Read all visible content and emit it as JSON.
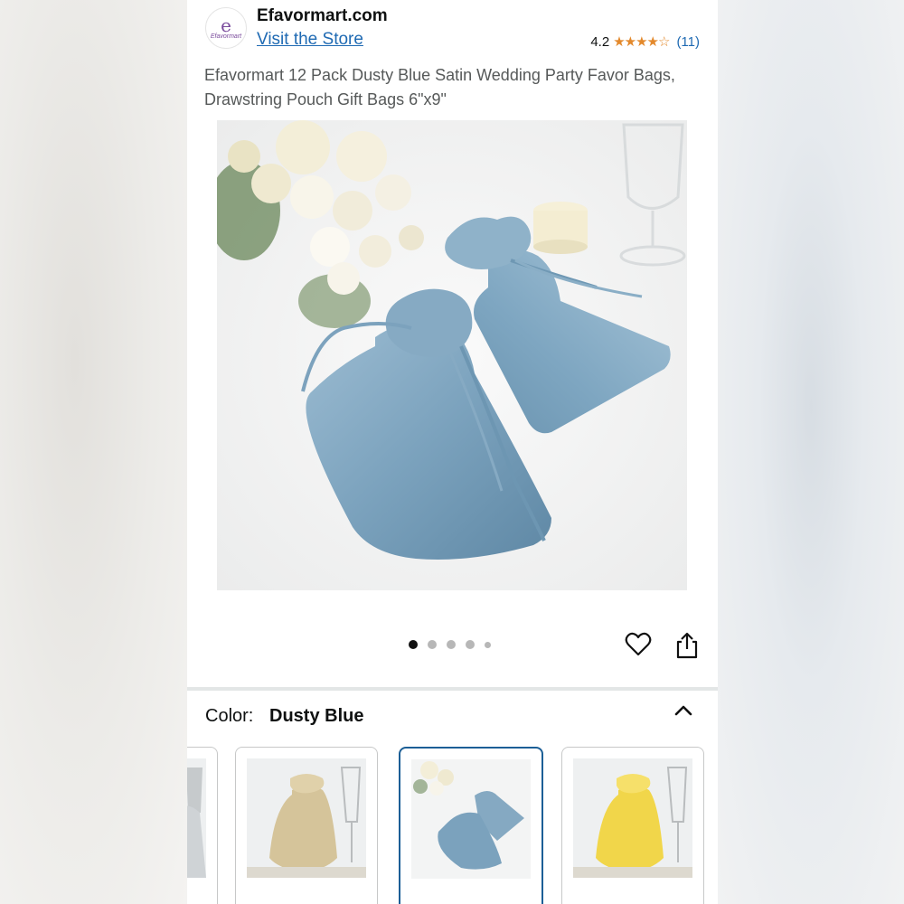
{
  "store": {
    "logo_text": "e",
    "logo_subtext": "Efavormart",
    "name": "Efavormart.com",
    "visit_link": "Visit the Store"
  },
  "rating": {
    "value": "4.2",
    "stars": 4.2,
    "count": "(11)"
  },
  "product": {
    "title": "Efavormart 12 Pack Dusty Blue Satin Wedding Party Favor Bags, Drawstring Pouch Gift Bags 6\"x9\""
  },
  "gallery": {
    "image_count": 5,
    "active_index": 0
  },
  "color_selector": {
    "label": "Color:",
    "selected": "Dusty Blue",
    "options": [
      {
        "color": "silver",
        "selected": false
      },
      {
        "color": "champagne",
        "selected": false
      },
      {
        "color": "dusty blue",
        "selected": true
      },
      {
        "color": "yellow",
        "selected": false
      }
    ]
  },
  "colors": {
    "link": "#1f6ab3",
    "star": "#e3892c",
    "selected_border": "#1c5f96",
    "dusty_blue": "#7ba2bd",
    "champagne": "#d5c49a",
    "yellow": "#f1d64a"
  },
  "icons": {
    "favorite": "heart-icon",
    "share": "share-icon",
    "collapse": "chevron-up-icon"
  }
}
